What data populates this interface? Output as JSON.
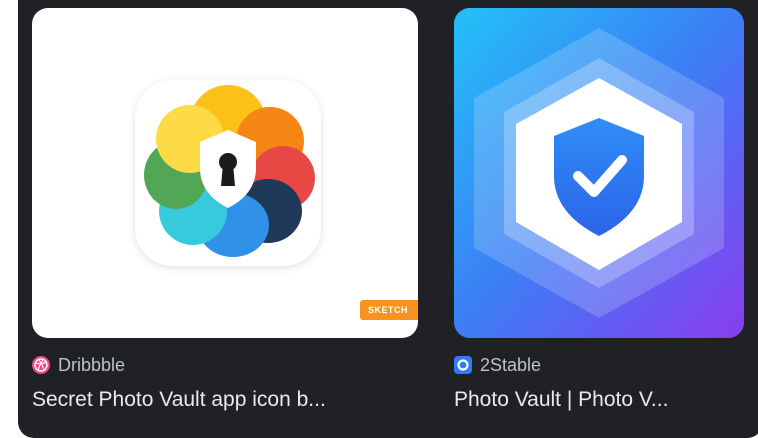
{
  "results": [
    {
      "source": "Dribbble",
      "title": "Secret Photo Vault app icon b...",
      "badge": "SKETCH",
      "favicon_icon": "dribbble-ball-icon",
      "accent": "#ea4c89"
    },
    {
      "source": "2Stable",
      "title": "Photo Vault | Photo V...",
      "favicon_icon": "2stable-ring-icon",
      "accent": "#2f7cf6"
    }
  ],
  "colors": {
    "panel_bg": "#202124",
    "title_text": "#e8eaed",
    "source_text": "#bdc1c6"
  }
}
